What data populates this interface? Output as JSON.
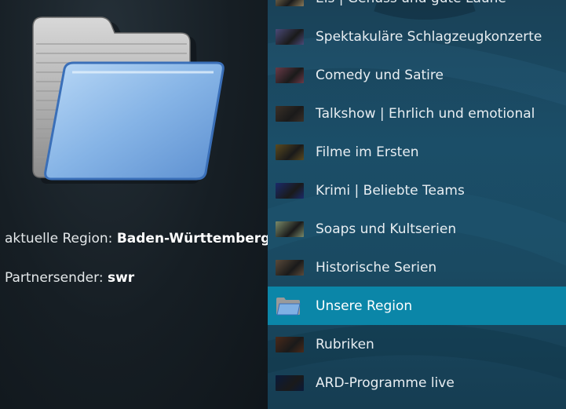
{
  "info": {
    "region_label": "aktuelle Region:",
    "region_value": "Baden-Württemberg",
    "partner_label": "Partnersender:",
    "partner_value": "swr"
  },
  "list": {
    "items": [
      {
        "label": "Eis | Genuss und gute Laune",
        "thumb": "#8a7a5a"
      },
      {
        "label": "Spektakuläre Schlagzeugkonzerte",
        "thumb": "#4a4a78"
      },
      {
        "label": "Comedy und Satire",
        "thumb": "#6a3a48"
      },
      {
        "label": "Talkshow | Ehrlich und emotional",
        "thumb": "#3a3028"
      },
      {
        "label": "Filme im Ersten",
        "thumb": "#5a4a20"
      },
      {
        "label": "Krimi | Beliebte Teams",
        "thumb": "#1a2a6a"
      },
      {
        "label": "Soaps und Kultserien",
        "thumb": "#7a8a6a"
      },
      {
        "label": "Historische Serien",
        "thumb": "#5a4a3a"
      },
      {
        "label": "Unsere Region",
        "thumb": "folder",
        "selected": true
      },
      {
        "label": "Rubriken",
        "thumb": "#4a2a1a"
      },
      {
        "label": "ARD-Programme live",
        "thumb": "#0a1a3a"
      }
    ]
  }
}
